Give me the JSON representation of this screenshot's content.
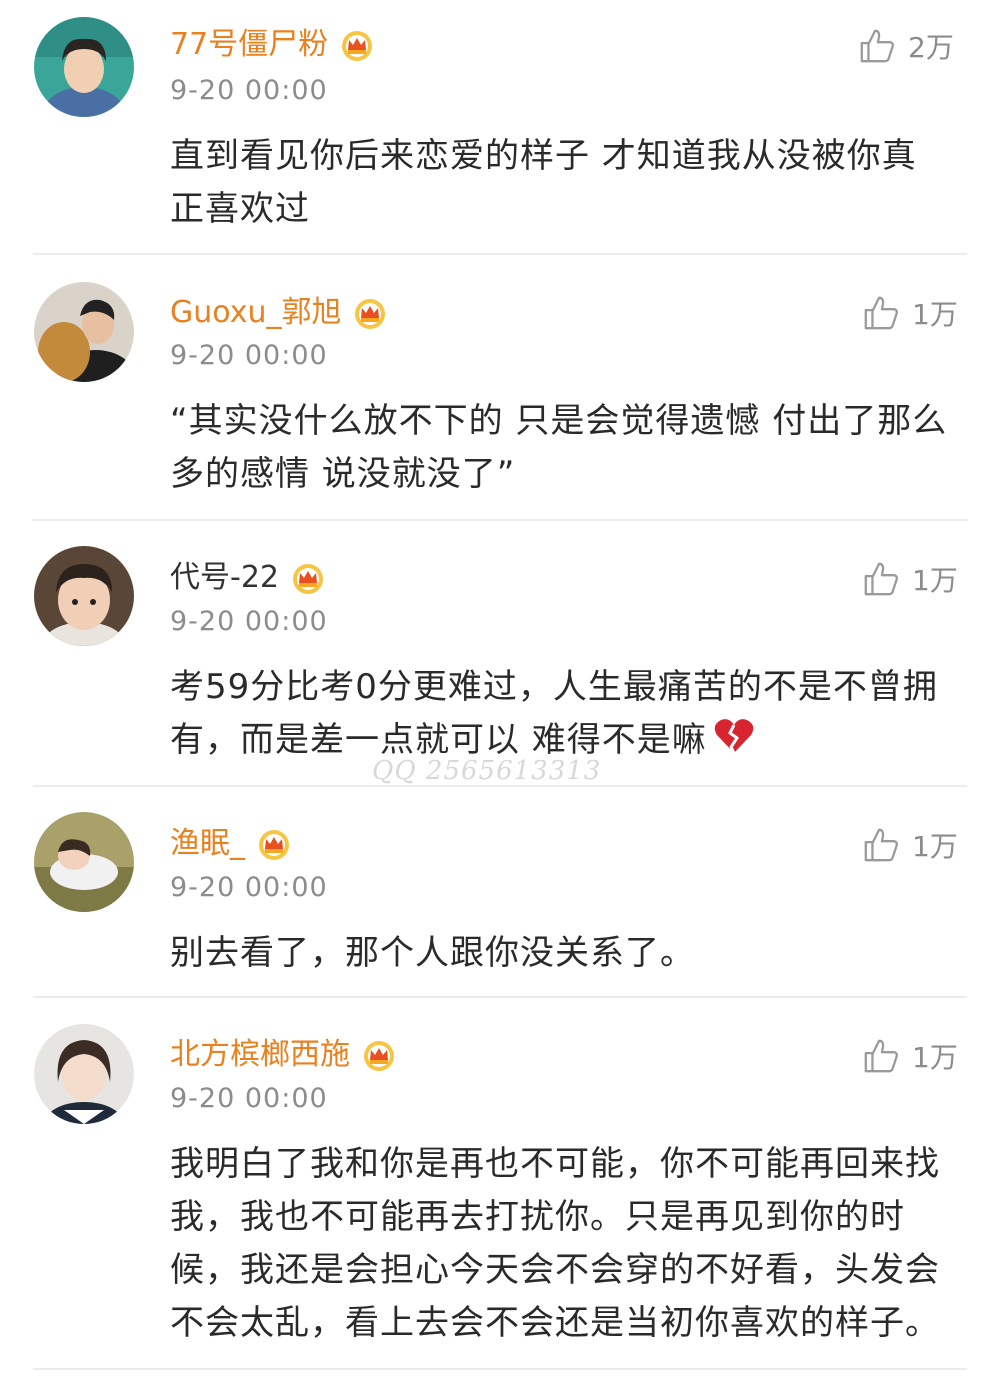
{
  "comments": [
    {
      "username": "77号僵尸粉",
      "time": "9-20 00:00",
      "likes": "2万",
      "text": "直到看见你后来恋爱的样子 才知道我从没被你真正喜欢过",
      "avatar": "avatar-icon",
      "badge": "crown-badge-icon"
    },
    {
      "username": "Guoxu_郭旭",
      "time": "9-20 00:00",
      "likes": "1万",
      "text": "“其实没什么放不下的 只是会觉得遗憾 付出了那么多的感情  说没就没了”",
      "avatar": "avatar-icon",
      "badge": "crown-badge-icon"
    },
    {
      "username": "代号-22",
      "time": "9-20 00:00",
      "likes": "1万",
      "text": "考59分比考0分更难过，人生最痛苦的不是不曾拥有，而是差一点就可以 难得不是嘛",
      "avatar": "avatar-icon",
      "badge": "crown-badge-icon",
      "emoji": "broken-heart-icon"
    },
    {
      "username": "渔眠_",
      "time": "9-20 00:00",
      "likes": "1万",
      "text": "别去看了，那个人跟你没关系了。",
      "avatar": "avatar-icon",
      "badge": "crown-badge-icon"
    },
    {
      "username": "北方槟榔西施",
      "time": "9-20 00:00",
      "likes": "1万",
      "text": "我明白了我和你是再也不可能，你不可能再回来找我，我也不可能再去打扰你。只是再见到你的时候，我还是会担心今天会不会穿的不好看，头发会不会太乱，看上去会不会还是当初你喜欢的样子。",
      "avatar": "avatar-icon",
      "badge": "crown-badge-icon"
    }
  ],
  "watermark": "QQ 2565613313",
  "colors": {
    "username_vip": "#e8811f",
    "meta_gray": "#8c8c8c",
    "text": "#2a2a2a",
    "divider": "#ececec"
  }
}
